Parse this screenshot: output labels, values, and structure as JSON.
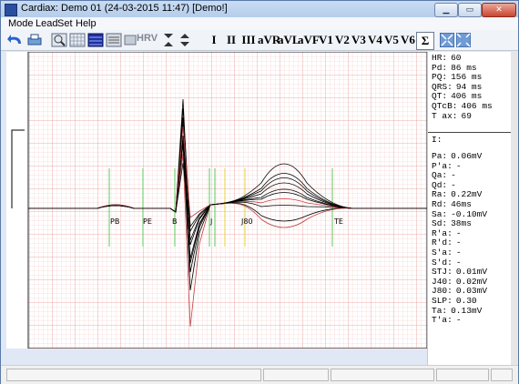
{
  "window": {
    "title": "Cardiax: Demo 01 (24-03-2015 11:47)  [Demo!]"
  },
  "menu": [
    "Mode",
    "Lead",
    "Set",
    "Help"
  ],
  "toolbar": {
    "hrv_label": "HRV",
    "leads": [
      "I",
      "II",
      "III",
      "aVR",
      "aVL",
      "aVF",
      "V1",
      "V2",
      "V3",
      "V4",
      "V5",
      "V6",
      "Σ"
    ],
    "selected_lead": "Σ"
  },
  "summary": [
    {
      "label": "HR:",
      "value": "60"
    },
    {
      "label": "Pd:",
      "value": "86 ms"
    },
    {
      "label": "PQ:",
      "value": "156 ms"
    },
    {
      "label": "QRS:",
      "value": "94 ms"
    },
    {
      "label": "QT:",
      "value": "406 ms"
    },
    {
      "label": "QTcB:",
      "value": "406 ms"
    },
    {
      "label": "T ax:",
      "value": "69"
    }
  ],
  "lead_header": "I:",
  "details": [
    {
      "label": "Pa:",
      "value": "0.06mV"
    },
    {
      "label": "P'a:",
      "value": "-"
    },
    {
      "label": "Qa:",
      "value": "-"
    },
    {
      "label": "Qd:",
      "value": "-"
    },
    {
      "label": "Ra:",
      "value": "0.22mV"
    },
    {
      "label": "Rd:",
      "value": "46ms"
    },
    {
      "label": "Sa:",
      "value": "-0.10mV"
    },
    {
      "label": "Sd:",
      "value": "38ms"
    },
    {
      "label": "R'a:",
      "value": "-"
    },
    {
      "label": "R'd:",
      "value": "-"
    },
    {
      "label": "S'a:",
      "value": "-"
    },
    {
      "label": "S'd:",
      "value": "-"
    },
    {
      "label": "STJ:",
      "value": "0.01mV"
    },
    {
      "label": "J40:",
      "value": "0.02mV"
    },
    {
      "label": "J80:",
      "value": "0.03mV"
    },
    {
      "label": "SLP:",
      "value": "0.30"
    },
    {
      "label": "Ta:",
      "value": "0.13mV"
    },
    {
      "label": "T'a:",
      "value": "-"
    }
  ],
  "markers": [
    "PB",
    "PE",
    "B",
    "J",
    "J80",
    "TE"
  ],
  "colors": {
    "grid_minor": "#f4c6c6",
    "grid_major": "#e89a9a",
    "marker_green": "#5ec85e",
    "marker_yellow": "#e8d23a",
    "trace": "#000000"
  }
}
